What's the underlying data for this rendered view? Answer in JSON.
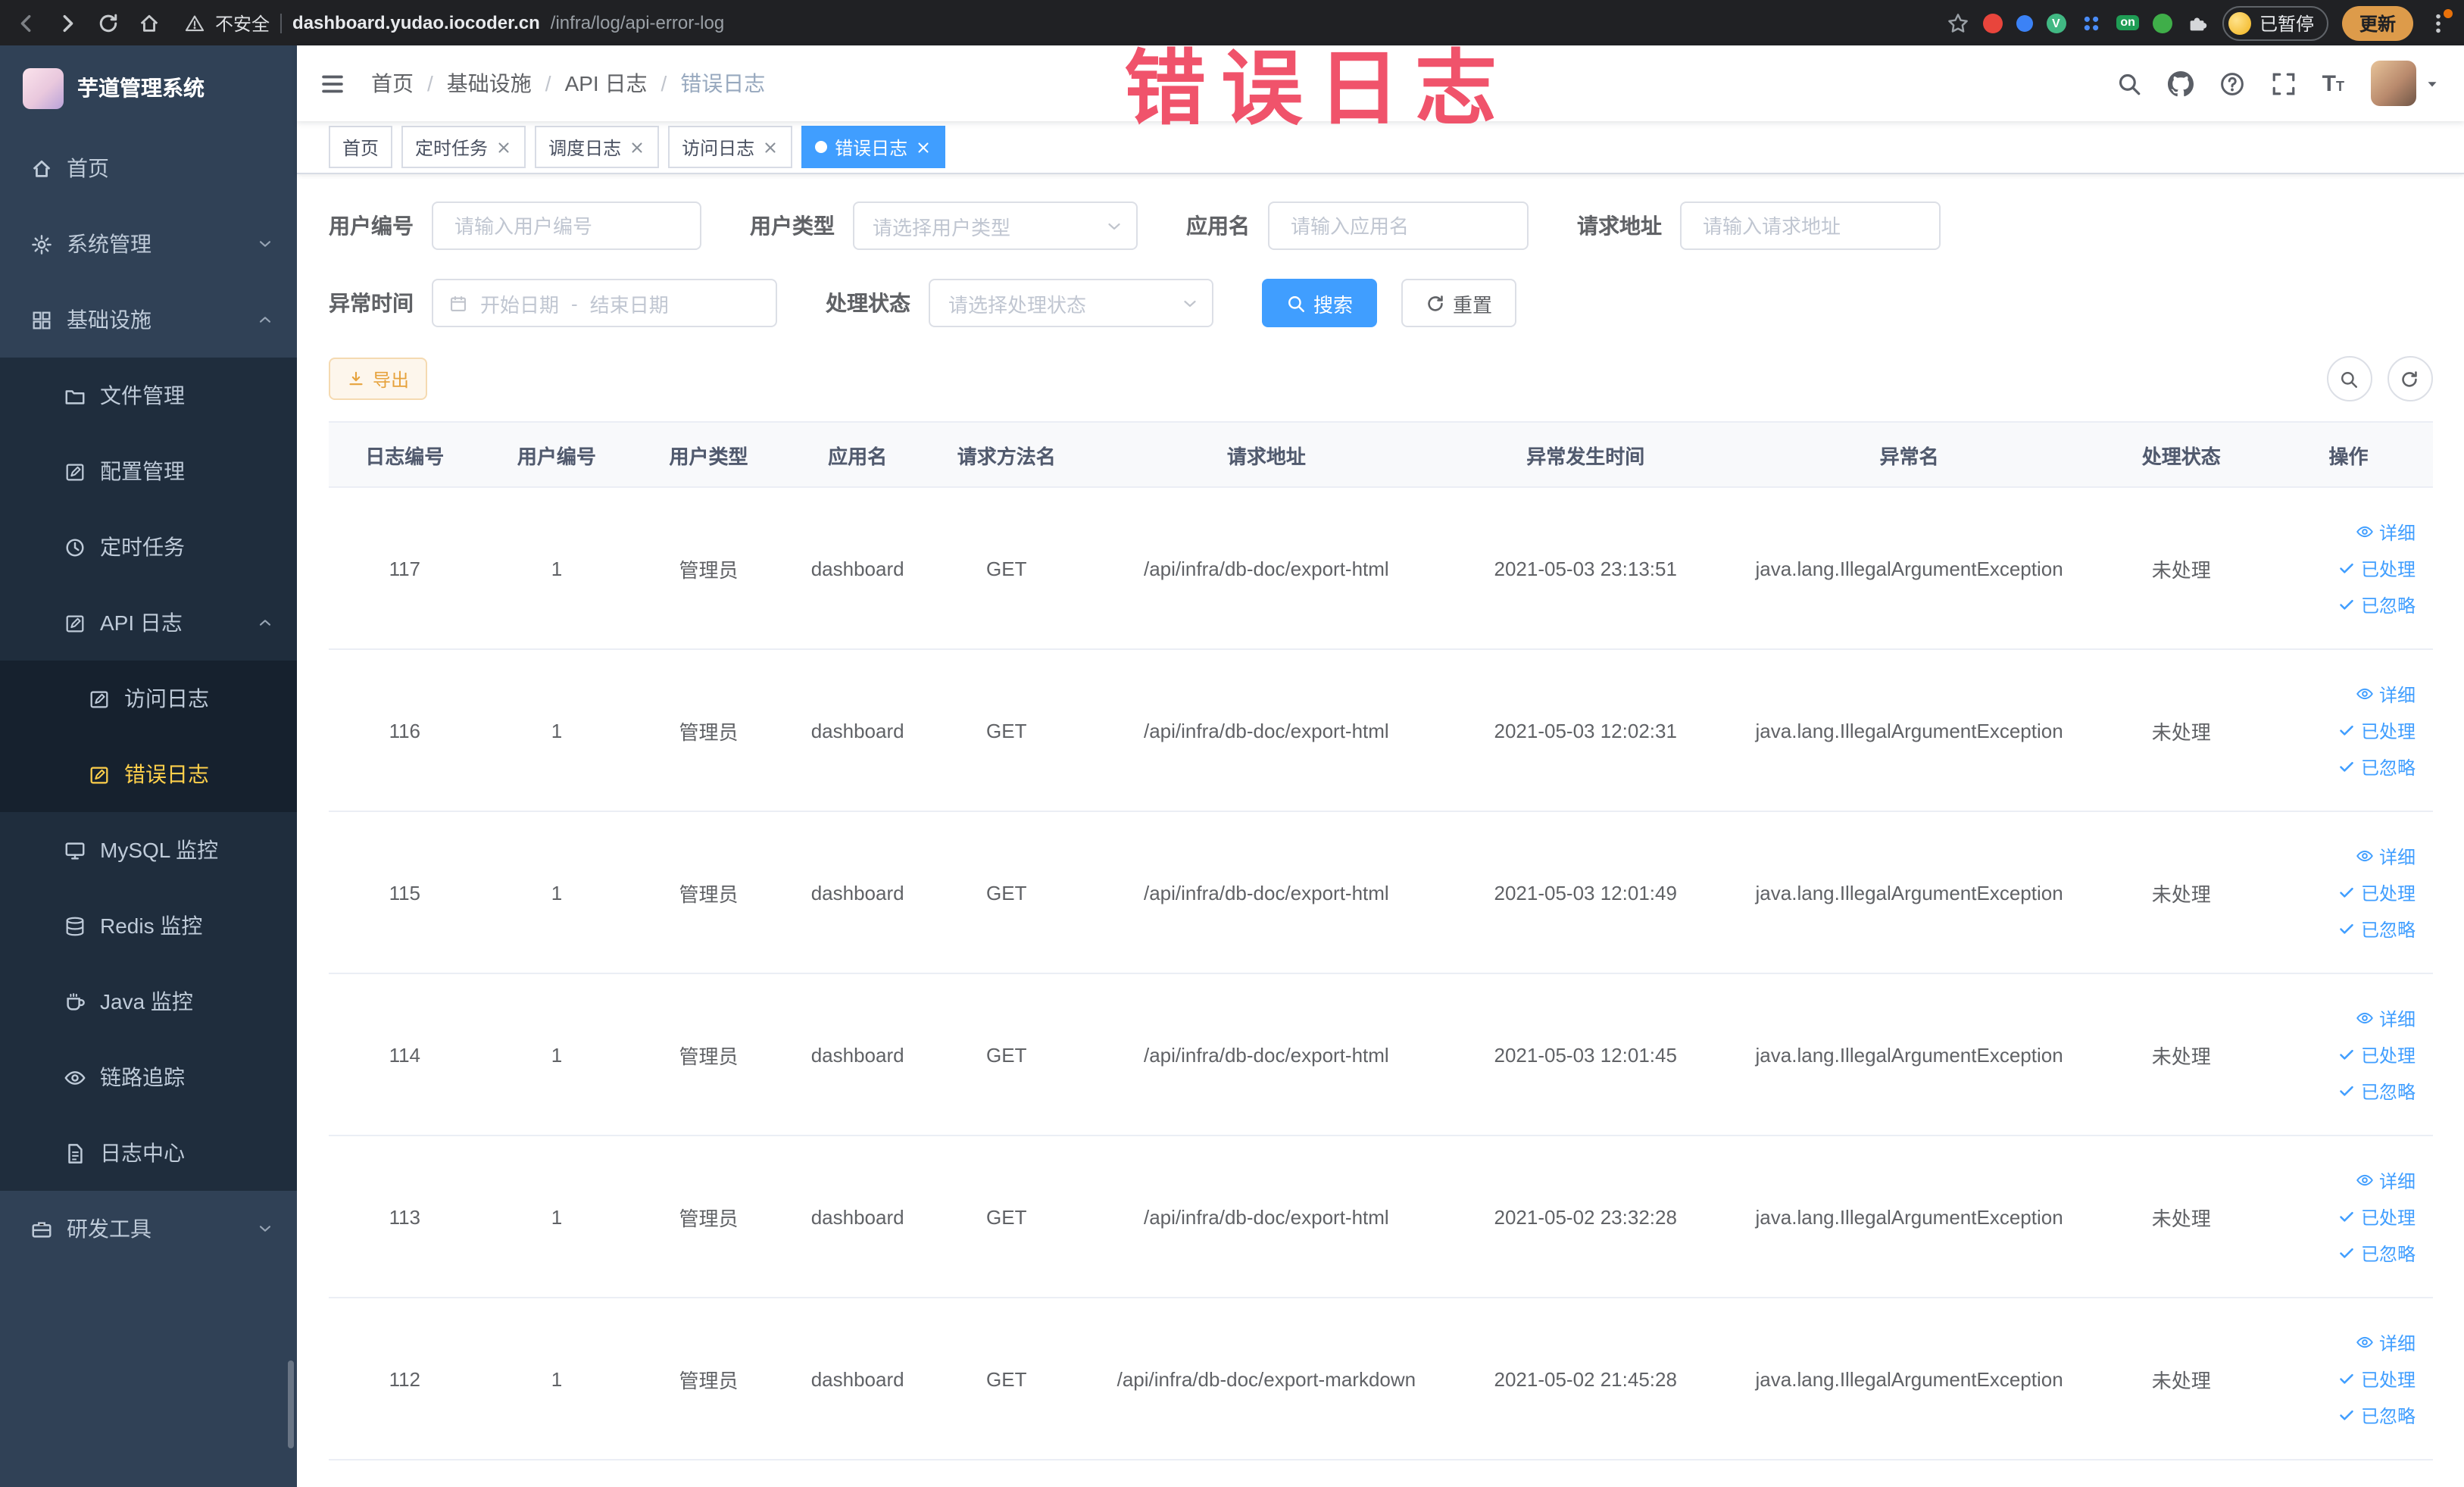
{
  "browser": {
    "security_label": "不安全",
    "url_domain": "dashboard.yudao.iocoder.cn",
    "url_path": "/infra/log/api-error-log",
    "vue_badge": "V",
    "extension_on_badge": "on",
    "paused_label": "已暂停",
    "update_label": "更新"
  },
  "annotation": {
    "text": "错误日志"
  },
  "sidebar": {
    "logo_title": "芋道管理系统",
    "items": [
      {
        "label": "首页"
      },
      {
        "label": "系统管理"
      },
      {
        "label": "基础设施"
      },
      {
        "label": "文件管理"
      },
      {
        "label": "配置管理"
      },
      {
        "label": "定时任务"
      },
      {
        "label": "API 日志"
      },
      {
        "label": "访问日志"
      },
      {
        "label": "错误日志"
      },
      {
        "label": "MySQL 监控"
      },
      {
        "label": "Redis 监控"
      },
      {
        "label": "Java 监控"
      },
      {
        "label": "链路追踪"
      },
      {
        "label": "日志中心"
      },
      {
        "label": "研发工具"
      }
    ]
  },
  "breadcrumb": {
    "separator": "/",
    "items": [
      "首页",
      "基础设施",
      "API 日志",
      "错误日志"
    ]
  },
  "tabs": [
    {
      "label": "首页"
    },
    {
      "label": "定时任务"
    },
    {
      "label": "调度日志"
    },
    {
      "label": "访问日志"
    },
    {
      "label": "错误日志"
    }
  ],
  "filters": {
    "user_id_label": "用户编号",
    "user_id_placeholder": "请输入用户编号",
    "user_type_label": "用户类型",
    "user_type_placeholder": "请选择用户类型",
    "app_name_label": "应用名",
    "app_name_placeholder": "请输入应用名",
    "request_url_label": "请求地址",
    "request_url_placeholder": "请输入请求地址",
    "exception_time_label": "异常时间",
    "date_start_placeholder": "开始日期",
    "date_separator": "-",
    "date_end_placeholder": "结束日期",
    "process_status_label": "处理状态",
    "process_status_placeholder": "请选择处理状态",
    "search_label": "搜索",
    "reset_label": "重置"
  },
  "toolbar": {
    "export_label": "导出"
  },
  "table": {
    "columns": [
      "日志编号",
      "用户编号",
      "用户类型",
      "应用名",
      "请求方法名",
      "请求地址",
      "异常发生时间",
      "异常名",
      "处理状态",
      "操作"
    ],
    "action_labels": {
      "detail": "详细",
      "process": "已处理",
      "ignore": "已忽略"
    },
    "rows": [
      {
        "id": "117",
        "user_id": "1",
        "user_type": "管理员",
        "app_name": "dashboard",
        "method": "GET",
        "url": "/api/infra/db-doc/export-html",
        "time": "2021-05-03 23:13:51",
        "exception": "java.lang.IllegalArgumentException",
        "status": "未处理"
      },
      {
        "id": "116",
        "user_id": "1",
        "user_type": "管理员",
        "app_name": "dashboard",
        "method": "GET",
        "url": "/api/infra/db-doc/export-html",
        "time": "2021-05-03 12:02:31",
        "exception": "java.lang.IllegalArgumentException",
        "status": "未处理"
      },
      {
        "id": "115",
        "user_id": "1",
        "user_type": "管理员",
        "app_name": "dashboard",
        "method": "GET",
        "url": "/api/infra/db-doc/export-html",
        "time": "2021-05-03 12:01:49",
        "exception": "java.lang.IllegalArgumentException",
        "status": "未处理"
      },
      {
        "id": "114",
        "user_id": "1",
        "user_type": "管理员",
        "app_name": "dashboard",
        "method": "GET",
        "url": "/api/infra/db-doc/export-html",
        "time": "2021-05-03 12:01:45",
        "exception": "java.lang.IllegalArgumentException",
        "status": "未处理"
      },
      {
        "id": "113",
        "user_id": "1",
        "user_type": "管理员",
        "app_name": "dashboard",
        "method": "GET",
        "url": "/api/infra/db-doc/export-html",
        "time": "2021-05-02 23:32:28",
        "exception": "java.lang.IllegalArgumentException",
        "status": "未处理"
      },
      {
        "id": "112",
        "user_id": "1",
        "user_type": "管理员",
        "app_name": "dashboard",
        "method": "GET",
        "url": "/api/infra/db-doc/export-markdown",
        "time": "2021-05-02 21:45:28",
        "exception": "java.lang.IllegalArgumentException",
        "status": "未处理"
      }
    ]
  },
  "colors": {
    "primary": "#409eff",
    "menu_active": "#ffd04b",
    "warning": "#e6a23c",
    "annotation": "#ef4760"
  }
}
